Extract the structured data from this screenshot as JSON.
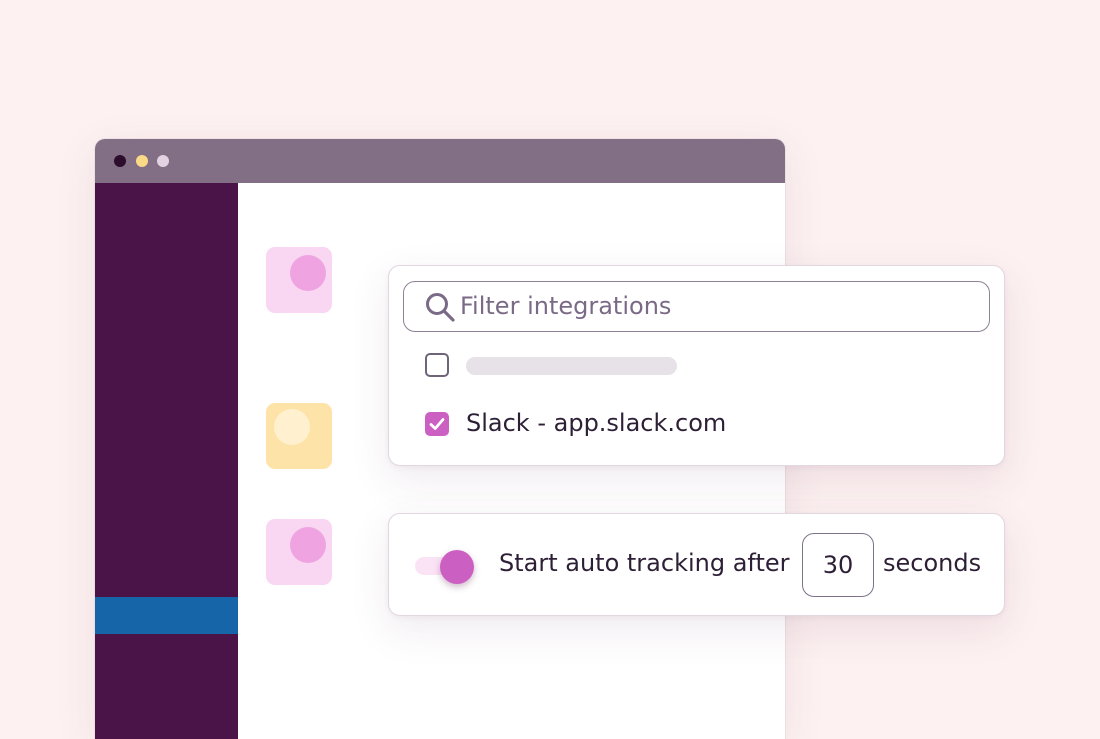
{
  "colors": {
    "page_background": "#fdf1f1",
    "titlebar": "#826f86",
    "sidebar": "#4a1449",
    "sidebar_active": "#1565a8",
    "accent": "#cc5fc2",
    "window_controls": [
      "#2c0d2b",
      "#fbd986",
      "#e3d2e1"
    ]
  },
  "filter": {
    "search_placeholder": "Filter integrations",
    "items": [
      {
        "label": "",
        "checked": false
      },
      {
        "label": "Slack - app.slack.com",
        "checked": true
      }
    ]
  },
  "tracking": {
    "enabled": true,
    "label_prefix": "Start auto tracking after",
    "seconds_value": "30",
    "label_suffix": "seconds"
  }
}
